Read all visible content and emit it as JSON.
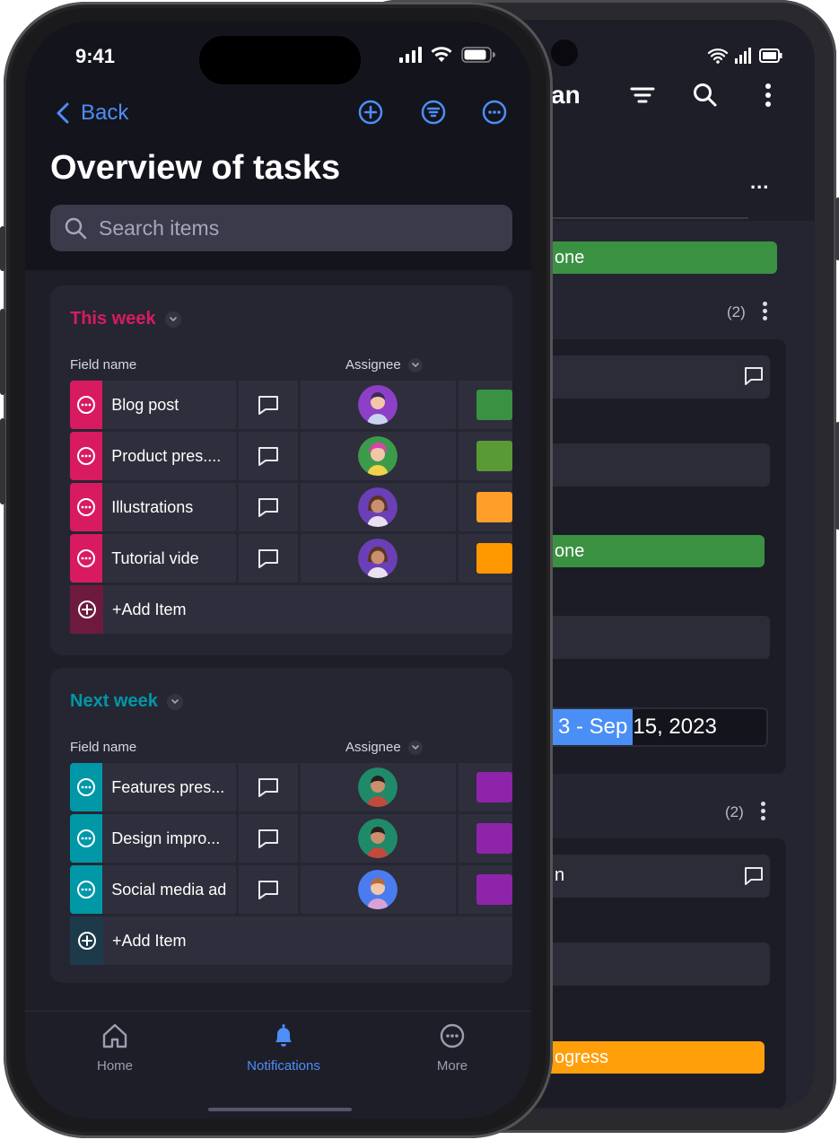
{
  "colors": {
    "accent": "#4d8ef7",
    "this_week": "#d81b60",
    "next_week": "#0097a7",
    "done_green": "#3b9142",
    "progress_orange": "#ff9f0a"
  },
  "status_bar": {
    "time": "9:41"
  },
  "header": {
    "back_label": "Back",
    "title": "Overview of tasks",
    "icons": [
      "add-circle-icon",
      "filter-circle-icon",
      "more-circle-icon"
    ]
  },
  "search": {
    "placeholder": "Search items"
  },
  "groups": [
    {
      "title": "This week",
      "color": "#d81b60",
      "col_field": "Field name",
      "col_assignee": "Assignee",
      "items": [
        {
          "name": "Blog post",
          "status_color": "#3b9142"
        },
        {
          "name": "Product pres....",
          "status_color": "#5a9a36"
        },
        {
          "name": "Illustrations",
          "status_color": "#ff9f2a"
        },
        {
          "name": "Tutorial vide",
          "status_color": "#ff9800"
        }
      ],
      "add_label": "+Add Item"
    },
    {
      "title": "Next week",
      "color": "#0097a7",
      "col_field": "Field name",
      "col_assignee": "Assignee",
      "items": [
        {
          "name": "Features pres...",
          "status_color": "#8e24aa"
        },
        {
          "name": "Design impro...",
          "status_color": "#8e24aa"
        },
        {
          "name": "Social media ad",
          "status_color": "#8e24aa"
        }
      ],
      "add_label": "+Add Item"
    }
  ],
  "tabbar": {
    "items": [
      {
        "label": "Home",
        "icon": "home-icon"
      },
      {
        "label": "Notifications",
        "icon": "bell-icon",
        "active": true
      },
      {
        "label": "More",
        "icon": "more-icon"
      }
    ]
  },
  "back_phone": {
    "title_fragment": "an",
    "more_label": "...",
    "status_done_1": "one",
    "count_1": "(2)",
    "status_done_2": "one",
    "date_selected": "3 - Sep",
    "date_rest": "15, 2023",
    "count_2": "(2)",
    "row_fragment": "n",
    "status_progress": "ogress"
  }
}
